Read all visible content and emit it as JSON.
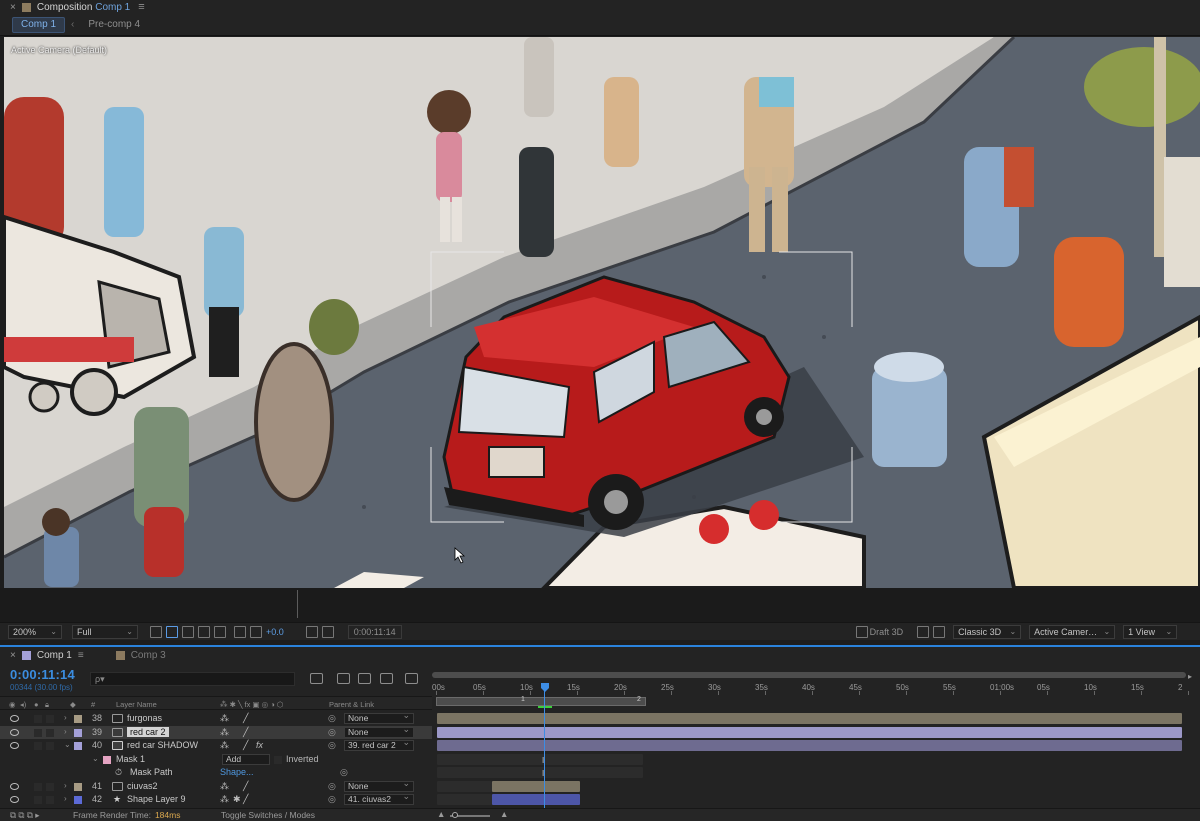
{
  "comp_panel": {
    "title_prefix": "Composition",
    "title_comp": "Comp 1",
    "tabs": [
      "Comp 1",
      "Pre-comp 4"
    ]
  },
  "viewer": {
    "camera_label": "Active Camera (Default)"
  },
  "viewer_toolbar": {
    "zoom": "200%",
    "resolution": "Full",
    "exposure": "+0.0",
    "timecode": "0:00:11:14",
    "draft_3d": "Draft 3D",
    "renderer": "Classic 3D",
    "view": "Active Camer…",
    "views": "1 View"
  },
  "timeline": {
    "tabs": [
      {
        "label": "Comp 1",
        "color": "#a4a0d8",
        "active": true
      },
      {
        "label": "Comp 3",
        "color": "#8c7a5f",
        "active": false
      }
    ],
    "timecode": "0:00:11:14",
    "frames": "00344 (30.00 fps)",
    "search_placeholder": "ρ▾",
    "columns": {
      "number": "#",
      "layer_name": "Layer Name",
      "parent": "Parent & Link"
    },
    "ruler_ticks": [
      "00s",
      "05s",
      "10s",
      "15s",
      "20s",
      "25s",
      "30s",
      "35s",
      "40s",
      "45s",
      "50s",
      "55s",
      "01:00s",
      "05s",
      "10s",
      "15s",
      "2"
    ],
    "range_markers": [
      "1",
      "2"
    ],
    "layers": [
      {
        "num": "38",
        "name": "furgonas",
        "parent": "None",
        "color": "#a79b84",
        "twirl": "›",
        "fx": false
      },
      {
        "num": "39",
        "name": "red car 2",
        "parent": "None",
        "color": "#a4a0d8",
        "twirl": "›",
        "fx": false
      },
      {
        "num": "40",
        "name": "red car SHADOW",
        "parent": "39. red car 2",
        "color": "#a4a0d8",
        "twirl": "⌄",
        "fx": true
      },
      {
        "num": "41",
        "name": "ciuvas2",
        "parent": "None",
        "color": "#a79b84",
        "twirl": "›",
        "fx": false
      },
      {
        "num": "42",
        "name": "Shape Layer 9",
        "parent": "41. ciuvas2",
        "color": "#5c6ad6",
        "twirl": "›",
        "fx": false
      }
    ],
    "mask": {
      "name": "Mask 1",
      "mode": "Add",
      "inverted_label": "Inverted",
      "path_label": "Mask Path",
      "path_value": "Shape..."
    },
    "footer": {
      "render_label": "Frame Render Time:",
      "render_value": "184ms",
      "toggle_label": "Toggle Switches / Modes"
    }
  }
}
